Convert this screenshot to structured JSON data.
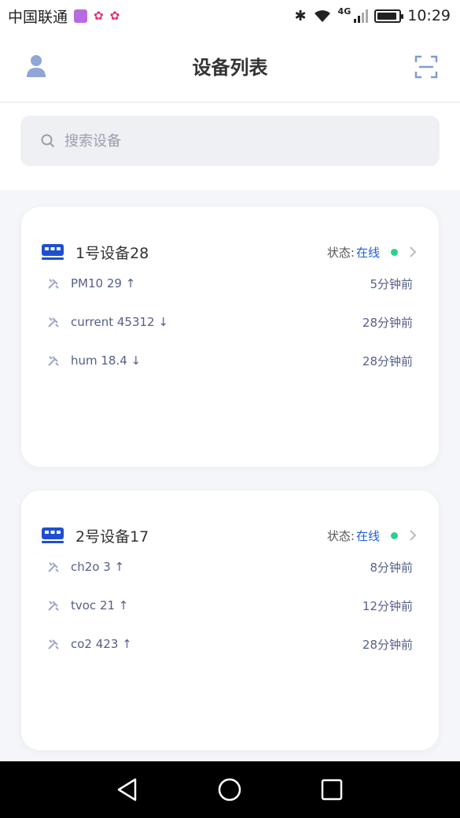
{
  "status_bar": {
    "carrier": "中国联通",
    "network": "4G",
    "time": "10:29",
    "battery_level": 0.9
  },
  "header": {
    "title": "设备列表"
  },
  "search": {
    "placeholder": "搜索设备"
  },
  "devices": [
    {
      "name": "1号设备28",
      "status_label": "状态:",
      "status_value": "在线",
      "metrics": [
        {
          "text": "PM10 29 ↑",
          "time": "5分钟前"
        },
        {
          "text": "current 45312 ↓",
          "time": "28分钟前"
        },
        {
          "text": "hum 18.4 ↓",
          "time": "28分钟前"
        }
      ]
    },
    {
      "name": "2号设备17",
      "status_label": "状态:",
      "status_value": "在线",
      "metrics": [
        {
          "text": "ch2o 3 ↑",
          "time": "8分钟前"
        },
        {
          "text": "tvoc 21 ↑",
          "time": "12分钟前"
        },
        {
          "text": "co2 423 ↑",
          "time": "28分钟前"
        }
      ]
    }
  ],
  "colors": {
    "accent": "#1a5fd6",
    "online": "#2ccf8f",
    "device_icon": "#1f4fd1"
  }
}
